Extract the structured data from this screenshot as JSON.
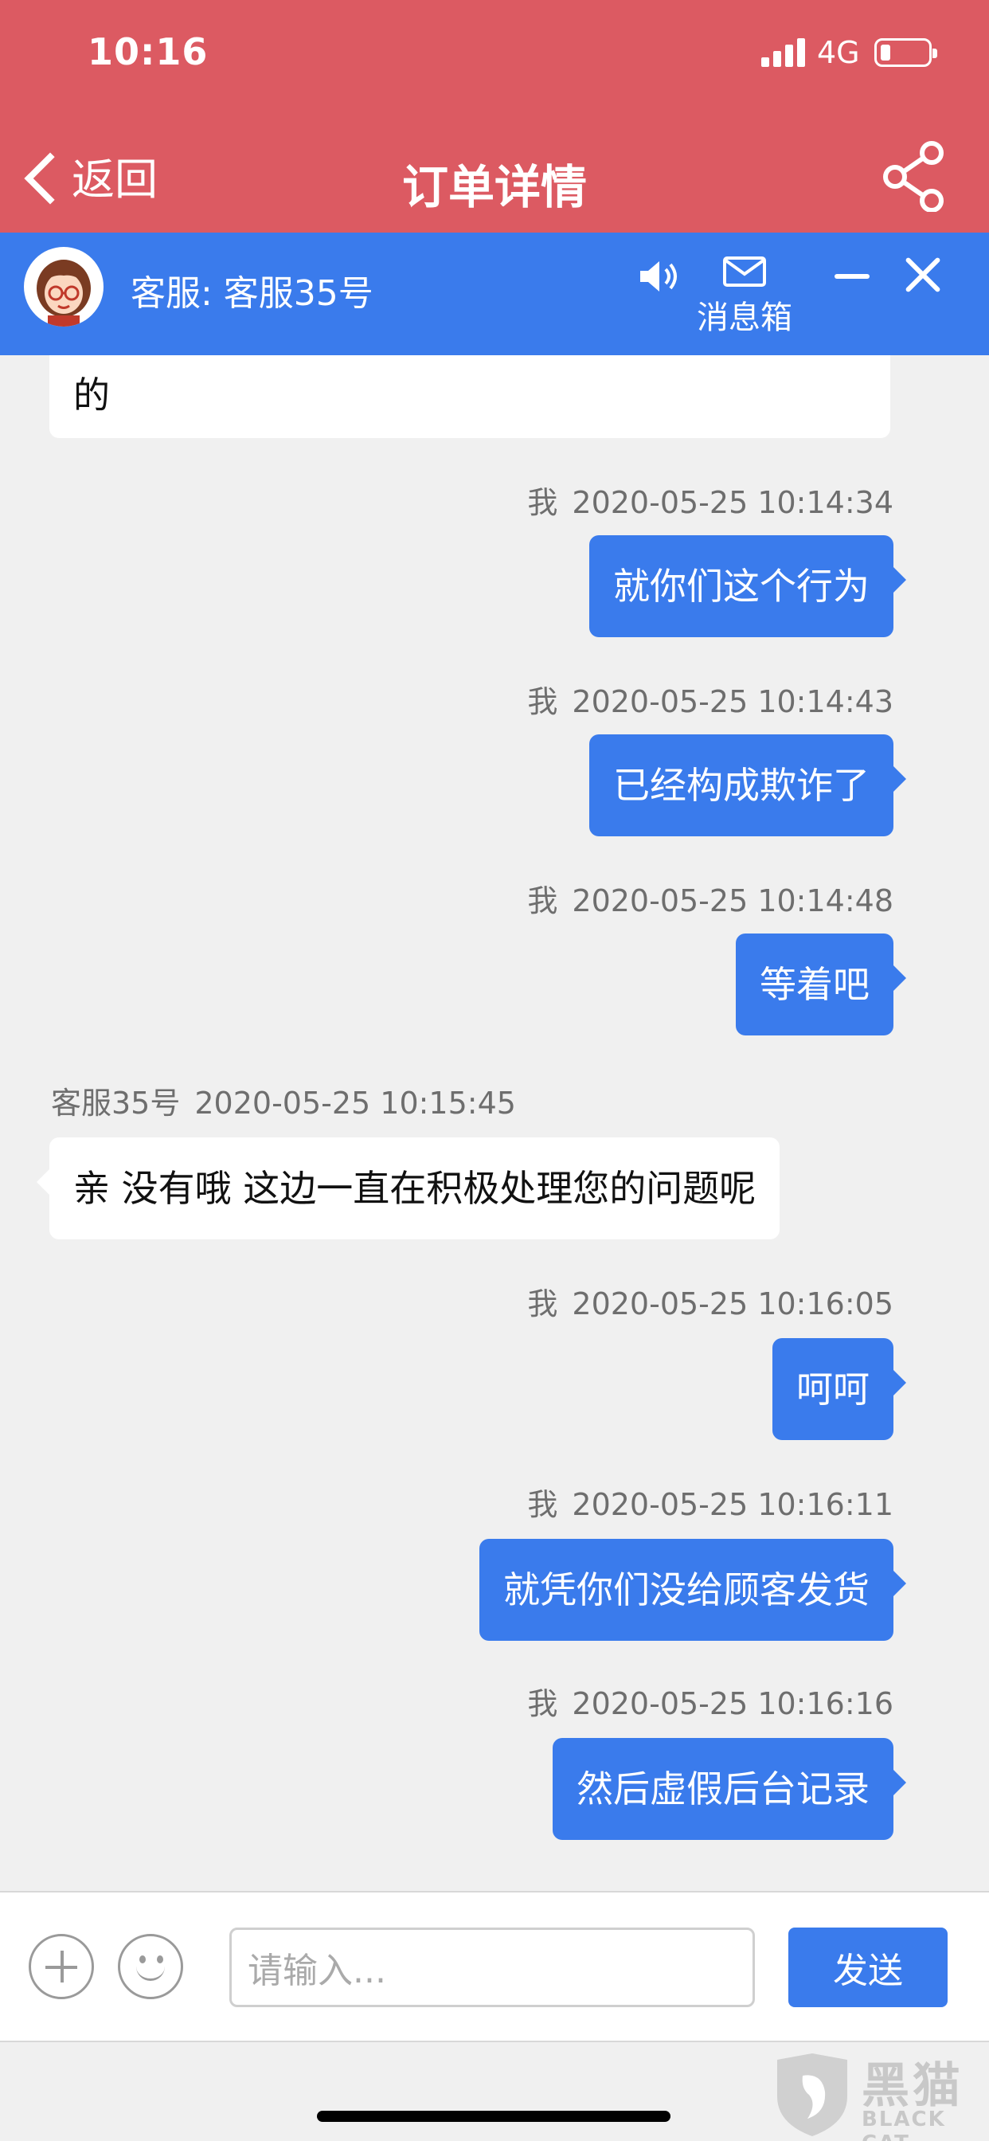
{
  "status_bar": {
    "time": "10:16",
    "network": "4G"
  },
  "nav": {
    "back_label": "返回",
    "title": "订单详情"
  },
  "chat_header": {
    "agent_label": "客服: 客服35号",
    "inbox_label": "消息箱"
  },
  "messages": {
    "partial_text": "的",
    "items": [
      {
        "sender": "我",
        "time": "2020-05-25 10:14:34",
        "text": "就你们这个行为"
      },
      {
        "sender": "我",
        "time": "2020-05-25 10:14:43",
        "text": "已经构成欺诈了"
      },
      {
        "sender": "我",
        "time": "2020-05-25 10:14:48",
        "text": "等着吧"
      },
      {
        "sender": "客服35号",
        "time": "2020-05-25 10:15:45",
        "text": "亲 没有哦 这边一直在积极处理您的问题呢"
      },
      {
        "sender": "我",
        "time": "2020-05-25 10:16:05",
        "text": "呵呵"
      },
      {
        "sender": "我",
        "time": "2020-05-25 10:16:11",
        "text": "就凭你们没给顾客发货"
      },
      {
        "sender": "我",
        "time": "2020-05-25 10:16:16",
        "text": "然后虚假后台记录"
      }
    ]
  },
  "composer": {
    "placeholder": "请输入...",
    "send_label": "发送"
  },
  "watermark": {
    "name": "黑猫",
    "sub": "BLACK CAT"
  },
  "colors": {
    "nav_red": "#dc5a62",
    "chat_blue": "#3a7bec",
    "background": "#f0f0f0"
  }
}
